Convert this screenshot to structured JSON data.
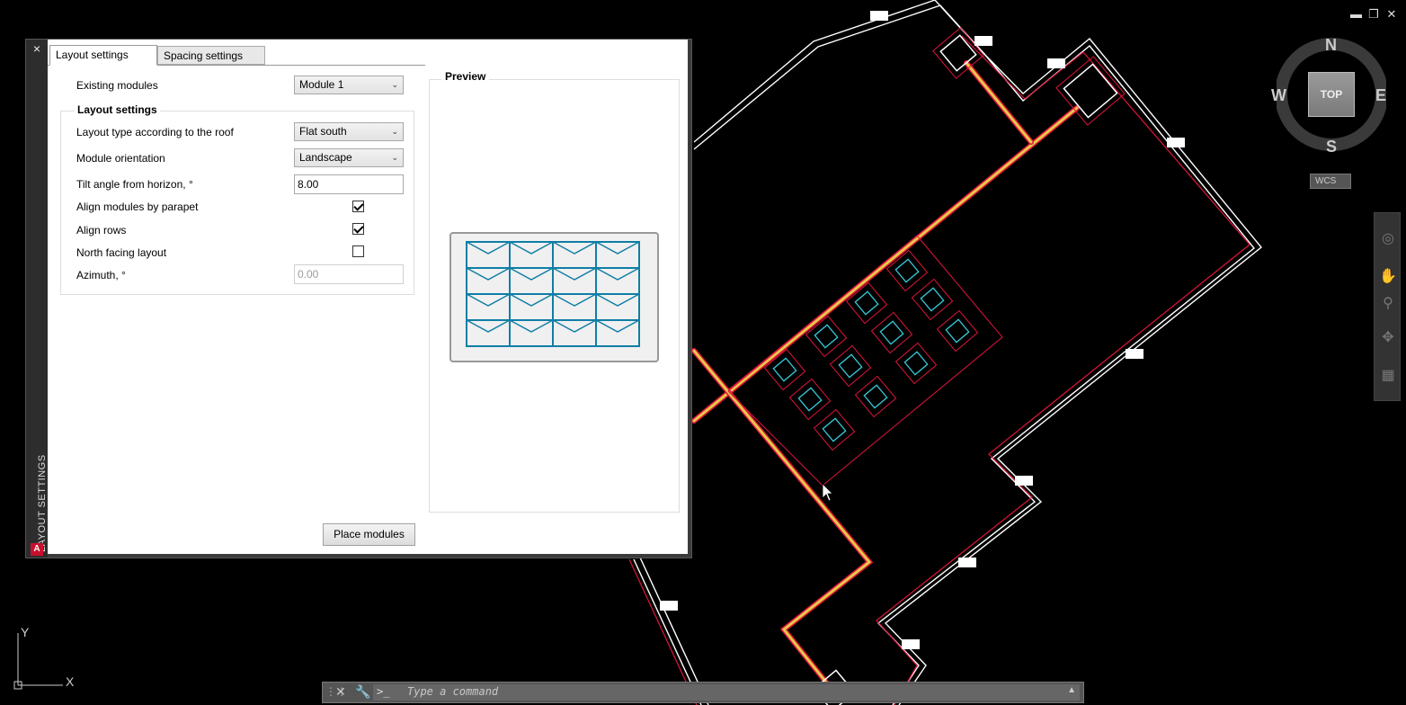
{
  "window_controls": {
    "minimize": "▬",
    "restore": "❐",
    "close": "✕"
  },
  "palette": {
    "close": "×",
    "vertical_title": "LAYOUT SETTINGS",
    "logo": "A",
    "tabs": [
      {
        "label": "Layout settings",
        "active": true
      },
      {
        "label": "Spacing settings",
        "active": false
      }
    ],
    "existing_modules": {
      "label": "Existing modules",
      "value": "Module 1"
    },
    "layout_group": {
      "title": "Layout settings",
      "layout_type": {
        "label": "Layout type according to the roof",
        "value": "Flat south"
      },
      "orientation": {
        "label": "Module orientation",
        "value": "Landscape"
      },
      "tilt": {
        "label": "Tilt angle from horizon, °",
        "value": "8.00"
      },
      "align_parapet": {
        "label": "Align modules by parapet",
        "checked": true
      },
      "align_rows": {
        "label": "Align rows",
        "checked": true
      },
      "north_facing": {
        "label": "North facing layout",
        "checked": false
      },
      "azimuth": {
        "label": "Azimuth, °",
        "value": "0.00"
      }
    },
    "preview": {
      "title": "Preview",
      "rows": 4,
      "cols": 4
    },
    "place_button": "Place modules"
  },
  "viewcube": {
    "n": "N",
    "s": "S",
    "e": "E",
    "w": "W",
    "top": "TOP",
    "wcs": "WCS"
  },
  "ucs": {
    "x": "X",
    "y": "Y"
  },
  "command_line": {
    "placeholder": "Type a command",
    "prompt_icon": ">_"
  },
  "colors": {
    "background": "#000000",
    "roof_outline": "#ffffff",
    "offset_line": "#e0143c",
    "ridge": "#e6c84a",
    "skylight": "#36c8d8",
    "module_blue": "#0f7ea6"
  }
}
